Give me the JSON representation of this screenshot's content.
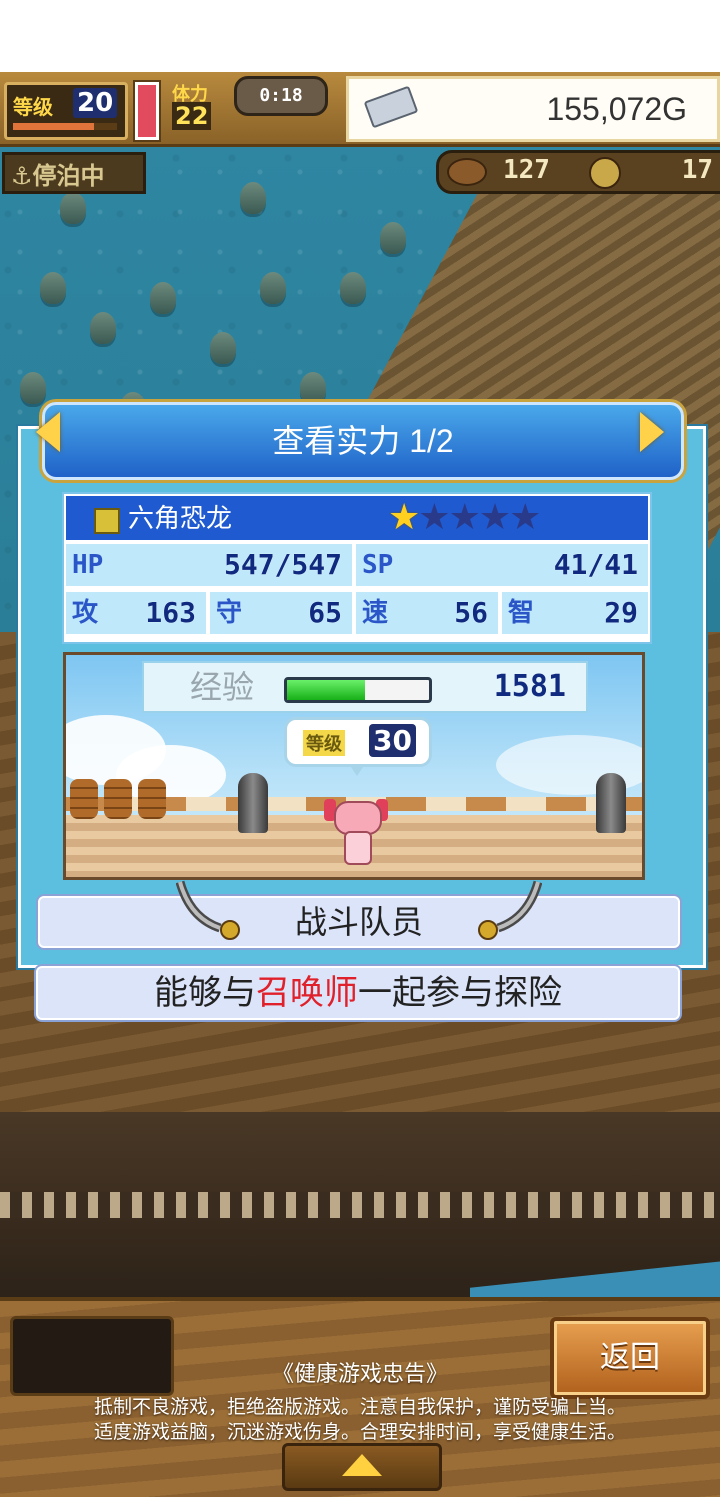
{
  "hud": {
    "level_label": "等级",
    "level": "20",
    "level_exp_fraction": 0.78,
    "stamina_label": "体力",
    "stamina": "22",
    "timer": "0:18",
    "gold": "155,072G",
    "status": "⚓停泊中",
    "resource_a": "127",
    "resource_b": "17"
  },
  "dialog": {
    "title": "查看实力 1/2",
    "monster": {
      "name": "六角恐龙",
      "stars_filled": 1,
      "stars_total": 5
    },
    "stats": {
      "hp_label": "HP",
      "hp": "547/547",
      "sp_label": "SP",
      "sp": "41/41",
      "atk_label": "攻",
      "atk": "163",
      "def_label": "守",
      "def": "65",
      "spd_label": "速",
      "spd": "56",
      "int_label": "智",
      "int": "29"
    },
    "exp_label": "经验",
    "exp_value": "1581",
    "exp_fraction": 0.55,
    "level_tag": "等级",
    "level": "30",
    "role": "战斗队员",
    "description": {
      "prefix": "能够与",
      "highlight": "召唤师",
      "suffix": "一起参与探险"
    }
  },
  "bottom": {
    "back_label": "返回",
    "notice_title": "《健康游戏忠告》",
    "notice_line1": "抵制不良游戏，拒绝盗版游戏。注意自我保护，谨防受骗上当。",
    "notice_line2": "适度游戏益脑，沉迷游戏伤身。合理安排时间，享受健康生活。"
  },
  "colors": {
    "accent_blue": "#1f5ad0",
    "highlight_red": "#e0202a",
    "star_gold": "#ffd020"
  }
}
